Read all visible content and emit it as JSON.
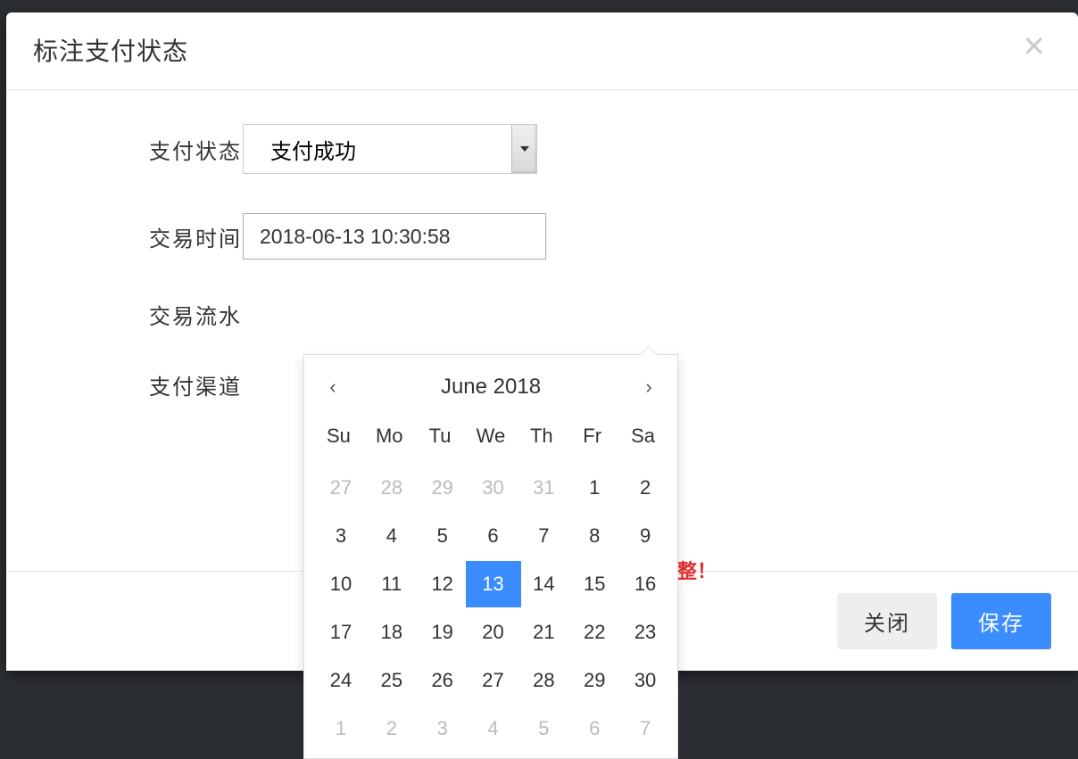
{
  "modal": {
    "title": "标注支付状态",
    "close_aria": "Close"
  },
  "form": {
    "payment_status_label": "支付状态",
    "payment_status_value": "支付成功",
    "transaction_time_label": "交易时间",
    "transaction_time_value": "2018-06-13 10:30:58",
    "transaction_serial_label": "交易流水",
    "payment_channel_label": "支付渠道"
  },
  "datepicker": {
    "title": "June 2018",
    "weekdays": [
      "Su",
      "Mo",
      "Tu",
      "We",
      "Th",
      "Fr",
      "Sa"
    ],
    "weeks": [
      [
        {
          "d": "27",
          "muted": true
        },
        {
          "d": "28",
          "muted": true
        },
        {
          "d": "29",
          "muted": true
        },
        {
          "d": "30",
          "muted": true
        },
        {
          "d": "31",
          "muted": true
        },
        {
          "d": "1"
        },
        {
          "d": "2"
        }
      ],
      [
        {
          "d": "3"
        },
        {
          "d": "4"
        },
        {
          "d": "5"
        },
        {
          "d": "6"
        },
        {
          "d": "7"
        },
        {
          "d": "8"
        },
        {
          "d": "9"
        }
      ],
      [
        {
          "d": "10"
        },
        {
          "d": "11"
        },
        {
          "d": "12"
        },
        {
          "d": "13",
          "selected": true
        },
        {
          "d": "14"
        },
        {
          "d": "15"
        },
        {
          "d": "16"
        }
      ],
      [
        {
          "d": "17"
        },
        {
          "d": "18"
        },
        {
          "d": "19"
        },
        {
          "d": "20"
        },
        {
          "d": "21"
        },
        {
          "d": "22"
        },
        {
          "d": "23"
        }
      ],
      [
        {
          "d": "24"
        },
        {
          "d": "25"
        },
        {
          "d": "26"
        },
        {
          "d": "27"
        },
        {
          "d": "28"
        },
        {
          "d": "29"
        },
        {
          "d": "30"
        }
      ],
      [
        {
          "d": "1",
          "muted": true
        },
        {
          "d": "2",
          "muted": true
        },
        {
          "d": "3",
          "muted": true
        },
        {
          "d": "4",
          "muted": true
        },
        {
          "d": "5",
          "muted": true
        },
        {
          "d": "6",
          "muted": true
        },
        {
          "d": "7",
          "muted": true
        }
      ]
    ]
  },
  "footer": {
    "close_label": "关闭",
    "save_label": "保存"
  },
  "bg": {
    "warn_fragment": "整！"
  }
}
